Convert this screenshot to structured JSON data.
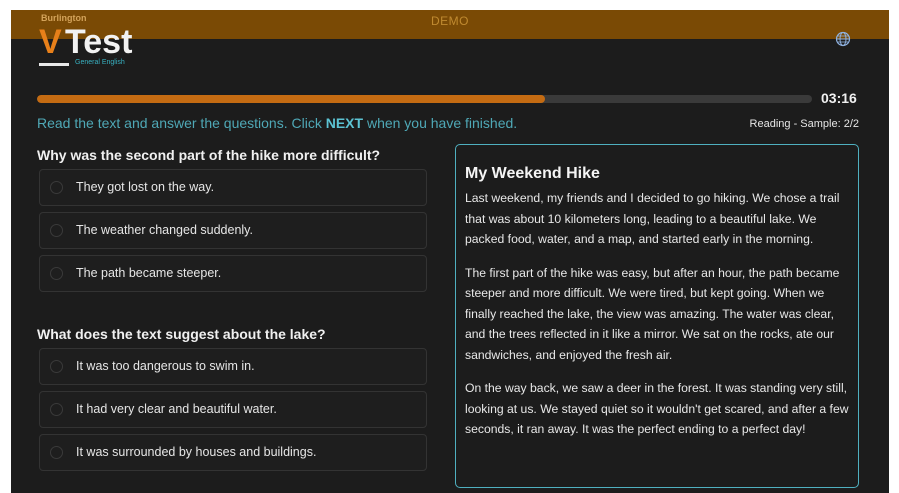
{
  "header": {
    "demo_label": "DEMO",
    "brand_top": "Burlington",
    "brand_v": "V",
    "brand_test": "Test",
    "brand_sub": "General English",
    "globe_icon": "globe-icon"
  },
  "progress": {
    "fraction": 0.655,
    "timer": "03:16"
  },
  "instruction": {
    "before": "Read the text and answer the questions. Click ",
    "next": "NEXT",
    "after": " when you have finished."
  },
  "section_label": "Reading - Sample: 2/2",
  "questions": [
    {
      "text": "Why was the second part of the hike more difficult?",
      "options": [
        "They got lost on the way.",
        "The weather changed suddenly.",
        "The path became steeper."
      ]
    },
    {
      "text": "What does the text suggest about the lake?",
      "options": [
        "It was too dangerous to swim in.",
        "It had very clear and beautiful water.",
        "It was surrounded by houses and buildings."
      ]
    }
  ],
  "passage": {
    "title": "My Weekend Hike",
    "paragraphs": [
      "Last weekend, my friends and I decided to go hiking. We chose a trail that was about 10 kilometers long, leading to a beautiful lake. We packed food, water, and a map, and started early in the morning.",
      "The first part of the hike was easy, but after an hour, the path became steeper and more difficult. We were tired, but kept going. When we finally reached the lake, the view was amazing. The water was clear, and the trees reflected in it like a mirror. We sat on the rocks, ate our sandwiches, and enjoyed the fresh air.",
      "On the way back, we saw a deer in the forest. It was standing very still, looking at us. We stayed quiet so it wouldn't get scared, and after a few seconds, it ran away. It was the perfect ending to a perfect day!"
    ]
  },
  "colors": {
    "accent_orange": "#c46b12",
    "accent_teal": "#4fb0c0",
    "background": "#1c1c1c"
  }
}
